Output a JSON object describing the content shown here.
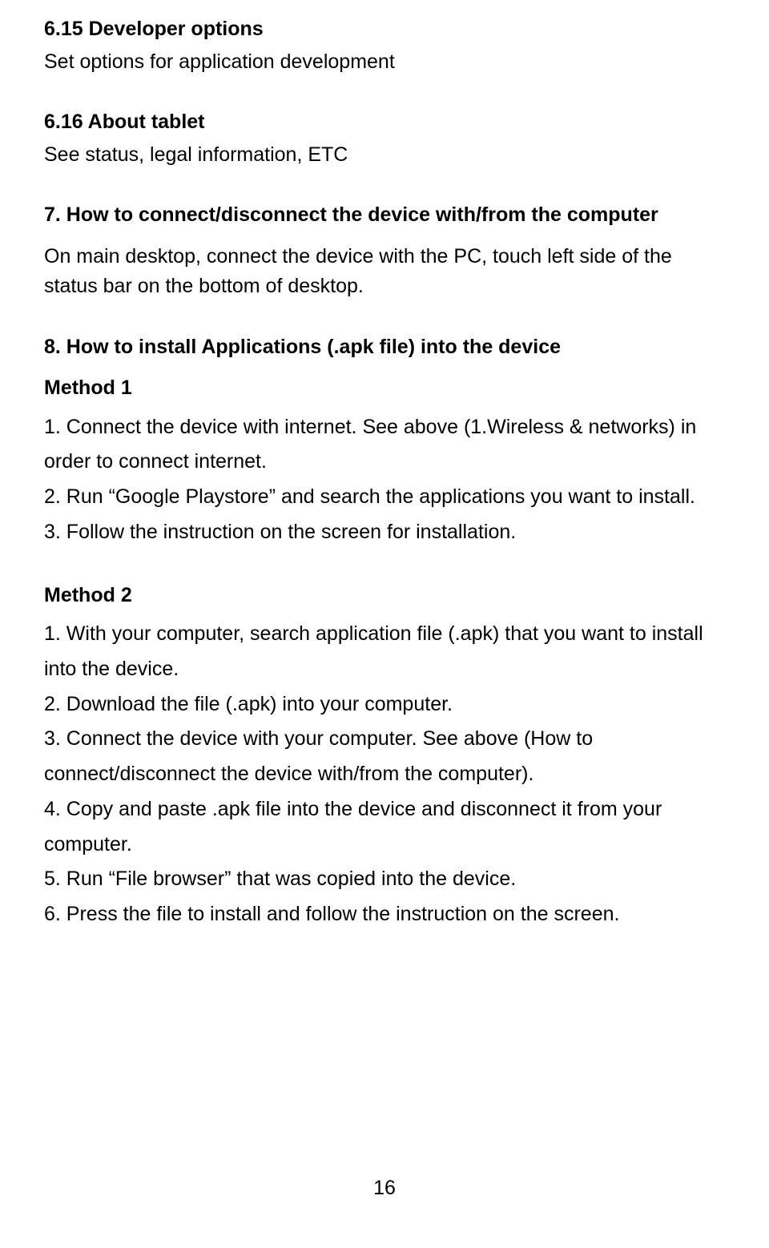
{
  "section_6_15": {
    "heading": "6.15 Developer options",
    "text": "Set options for application development"
  },
  "section_6_16": {
    "heading": "6.16 About tablet",
    "text": "See status, legal information, ETC"
  },
  "section_7": {
    "heading": "7. How to connect/disconnect the device with/from the computer",
    "text": "On main desktop, connect the device with the PC, touch left side of the status bar on the bottom of desktop."
  },
  "section_8": {
    "heading": "8. How to install Applications (.apk file) into the device",
    "method1": {
      "heading": "Method 1",
      "steps": [
        "1. Connect the device with internet. See above (1.Wireless & networks) in order to connect internet.",
        "2. Run “Google Playstore” and search the applications you want to install.",
        "3. Follow the instruction on the screen for installation."
      ]
    },
    "method2": {
      "heading": "Method 2",
      "steps": [
        "1. With your computer, search application file (.apk) that you want to install into the device.",
        "2. Download the file (.apk) into your computer.",
        "3. Connect the device with your computer. See above (How to connect/disconnect the device with/from the computer).",
        "4. Copy and paste .apk file into the device and disconnect it from your computer.",
        "5. Run “File browser” that was copied into the device.",
        "6. Press the file to install and follow the instruction on the screen."
      ]
    }
  },
  "page_number": "16"
}
